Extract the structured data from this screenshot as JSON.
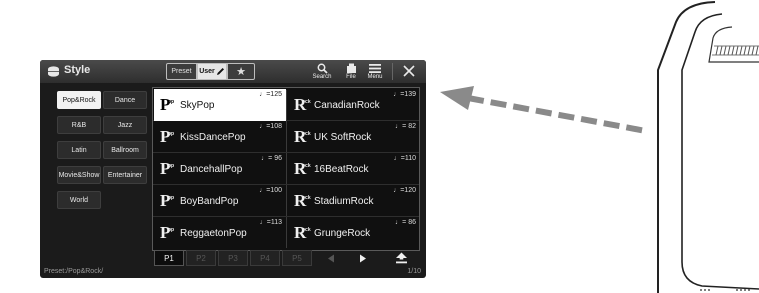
{
  "window": {
    "title": "Style",
    "close_label": "✕"
  },
  "source_tabs": {
    "preset": "Preset",
    "user": "User",
    "favorite": "★"
  },
  "toolbar": {
    "search": "Search",
    "file": "File",
    "menu": "Menu"
  },
  "categories": [
    {
      "label": "Pop&Rock",
      "active": true
    },
    {
      "label": "Dance",
      "active": false
    },
    {
      "label": "R&B",
      "active": false
    },
    {
      "label": "Jazz",
      "active": false
    },
    {
      "label": "Latin",
      "active": false
    },
    {
      "label": "Ballroom",
      "active": false
    },
    {
      "label": "Movie&Show",
      "active": false
    },
    {
      "label": "Entertainer",
      "active": false
    },
    {
      "label": "World",
      "active": false
    }
  ],
  "styles": [
    {
      "name": "SkyPop",
      "tempo": "♩=125",
      "logo_big": "P",
      "logo_small": "op",
      "selected": true
    },
    {
      "name": "CanadianRock",
      "tempo": "♩=139",
      "logo_big": "R",
      "logo_small": "ock",
      "selected": false
    },
    {
      "name": "KissDancePop",
      "tempo": "♩=108",
      "logo_big": "P",
      "logo_small": "op",
      "selected": false
    },
    {
      "name": "UK SoftRock",
      "tempo": "♩= 82",
      "logo_big": "R",
      "logo_small": "ock",
      "selected": false
    },
    {
      "name": "DancehallPop",
      "tempo": "♩= 96",
      "logo_big": "P",
      "logo_small": "op",
      "selected": false
    },
    {
      "name": "16BeatRock",
      "tempo": "♩=110",
      "logo_big": "R",
      "logo_small": "ock",
      "selected": false
    },
    {
      "name": "BoyBandPop",
      "tempo": "♩=100",
      "logo_big": "P",
      "logo_small": "op",
      "selected": false
    },
    {
      "name": "StadiumRock",
      "tempo": "♩=120",
      "logo_big": "R",
      "logo_small": "ock",
      "selected": false
    },
    {
      "name": "ReggaetonPop",
      "tempo": "♩=113",
      "logo_big": "P",
      "logo_small": "op",
      "selected": false
    },
    {
      "name": "GrungeRock",
      "tempo": "♩= 86",
      "logo_big": "R",
      "logo_small": "ock",
      "selected": false
    }
  ],
  "pages": [
    {
      "label": "P1",
      "active": true
    },
    {
      "label": "P2",
      "active": false
    },
    {
      "label": "P3",
      "active": false
    },
    {
      "label": "P4",
      "active": false
    },
    {
      "label": "P5",
      "active": false
    }
  ],
  "nav_icons": [
    "prev-page-icon",
    "next-page-icon",
    "up-folder-icon"
  ],
  "footer": {
    "path": "Preset:/Pop&Rock/",
    "page_count": "1/10"
  },
  "colors": {
    "screen_bg": "#1b1b1b",
    "selected_bg": "#ffffff",
    "arrow": "#8a8a8a"
  }
}
